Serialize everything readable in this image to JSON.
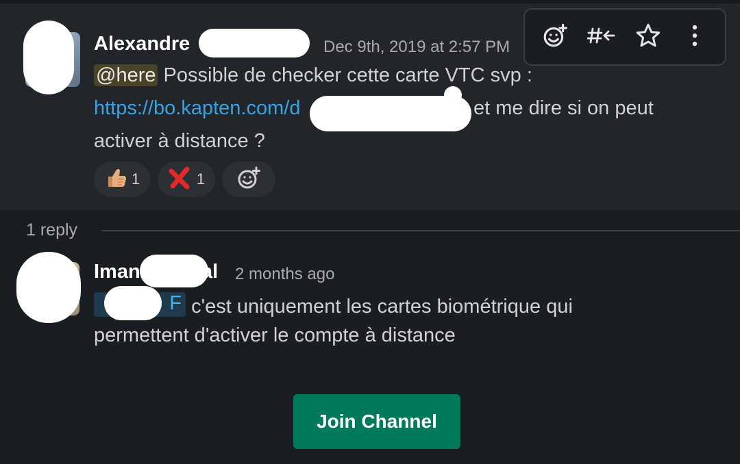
{
  "parent_message": {
    "author": "Alexandre",
    "timestamp": "Dec 9th, 2019 at 2:57 PM",
    "mention": "@here",
    "line1": "Possible de checker cette carte VTC svp :",
    "link_text": "https://bo.kapten.com/d",
    "line2_rest": "et me dire si on peut",
    "line3": "activer à distance ?",
    "reactions": [
      {
        "icon": "thumbs-up-icon",
        "count": "1"
      },
      {
        "icon": "red-x-icon",
        "count": "1"
      }
    ],
    "add_reaction_icon": "add-reaction-icon"
  },
  "toolbar": {
    "items": [
      "add-reaction-icon",
      "share-to-channel-icon",
      "star-icon",
      "more-actions-icon"
    ]
  },
  "thread": {
    "reply_count": "1 reply"
  },
  "reply_message": {
    "author_start": "Iman",
    "author_end": "al",
    "timestamp": "2 months ago",
    "mention_tail": "F",
    "line1": "c'est uniquement les cartes biométrique qui",
    "line2": "permettent d'activer le compte à distance"
  },
  "join_button": {
    "label": "Join Channel"
  },
  "colors": {
    "background": "#1a1d21",
    "message_hover": "#222529",
    "link": "#3aa3e3",
    "join_button": "#007a5a",
    "mention_here_bg": "#4a4328"
  }
}
